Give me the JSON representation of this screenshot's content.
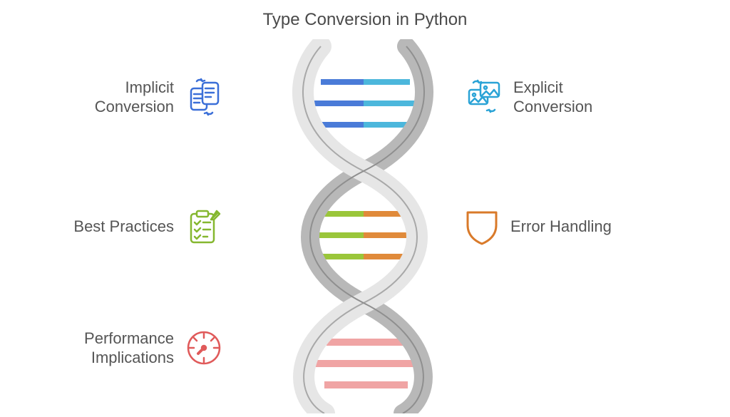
{
  "title": "Type Conversion in Python",
  "items": {
    "implicit": {
      "label": "Implicit\nConversion",
      "color": "#3b6fd8"
    },
    "explicit": {
      "label": "Explicit\nConversion",
      "color": "#2aa3d6"
    },
    "best": {
      "label": "Best Practices",
      "color": "#85b72f"
    },
    "error": {
      "label": "Error Handling",
      "color": "#d97a2a"
    },
    "perf": {
      "label": "Performance\nImplications",
      "color": "#e05a5a"
    }
  }
}
